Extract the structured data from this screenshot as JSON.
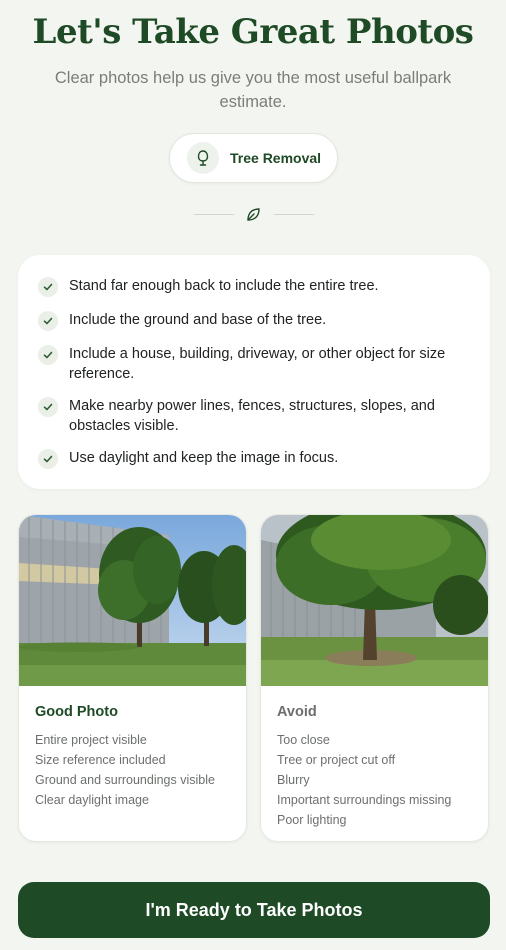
{
  "header": {
    "title": "Let's Take Great Photos",
    "subtitle": "Clear photos help us give you the most useful ballpark estimate."
  },
  "service_chip": {
    "label": "Tree Removal",
    "icon": "tree-icon"
  },
  "divider": {
    "icon": "leaf-icon"
  },
  "tips": [
    "Stand far enough back to include the entire tree.",
    "Include the ground and base of the tree.",
    "Include a house, building, driveway, or other object for size reference.",
    "Make nearby power lines, fences, structures, slopes, and obstacles visible.",
    "Use daylight and keep the image in focus."
  ],
  "good_example": {
    "heading": "Good Photo",
    "items": [
      "Entire project visible",
      "Size reference included",
      "Ground and surroundings visible",
      "Clear daylight image"
    ]
  },
  "avoid_example": {
    "heading": "Avoid",
    "items": [
      "Too close",
      "Tree or project cut off",
      "Blurry",
      "Important surroundings missing",
      "Poor lighting"
    ]
  },
  "cta": {
    "label": "I'm Ready to Take Photos"
  },
  "colors": {
    "brand_green": "#1e4a25",
    "background": "#f3f5f0",
    "avoid_heading": "#6c706c",
    "check_icon": "#2f5c35"
  }
}
